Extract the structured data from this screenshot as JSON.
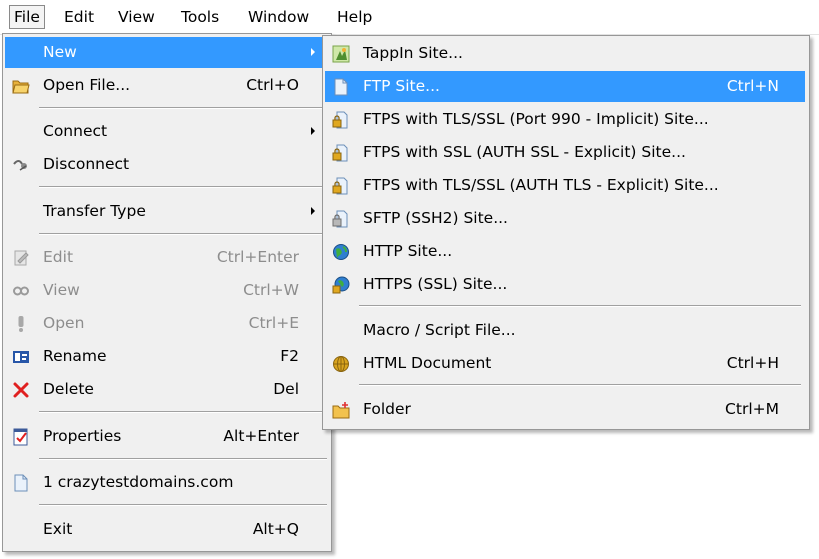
{
  "menubar": {
    "items": [
      "File",
      "Edit",
      "View",
      "Tools",
      "Window",
      "Help"
    ]
  },
  "file_menu": {
    "items": [
      {
        "label": "New",
        "shortcut": "",
        "submenu": true,
        "state": "highlighted",
        "icon": "none"
      },
      {
        "label": "Open File...",
        "shortcut": "Ctrl+O",
        "icon": "open-folder-icon"
      },
      {
        "label": "Connect",
        "shortcut": "",
        "submenu": true,
        "icon": "none"
      },
      {
        "label": "Disconnect",
        "shortcut": "",
        "icon": "disconnect-icon"
      },
      {
        "label": "Transfer Type",
        "shortcut": "",
        "submenu": true,
        "icon": "none"
      },
      {
        "label": "Edit",
        "shortcut": "Ctrl+Enter",
        "state": "disabled",
        "icon": "edit-icon"
      },
      {
        "label": "View",
        "shortcut": "Ctrl+W",
        "state": "disabled",
        "icon": "view-icon"
      },
      {
        "label": "Open",
        "shortcut": "Ctrl+E",
        "state": "disabled",
        "icon": "open-icon"
      },
      {
        "label": "Rename",
        "shortcut": "F2",
        "icon": "rename-icon"
      },
      {
        "label": "Delete",
        "shortcut": "Del",
        "icon": "delete-icon"
      },
      {
        "label": "Properties",
        "shortcut": "Alt+Enter",
        "icon": "properties-icon"
      },
      {
        "label": "1 crazytestdomains.com",
        "shortcut": "",
        "icon": "document-icon"
      },
      {
        "label": "Exit",
        "shortcut": "Alt+Q",
        "icon": "none"
      }
    ]
  },
  "new_submenu": {
    "items": [
      {
        "label": "TappIn Site...",
        "shortcut": "",
        "icon": "tappin-icon"
      },
      {
        "label": "FTP Site...",
        "shortcut": "Ctrl+N",
        "state": "highlighted",
        "icon": "document-icon"
      },
      {
        "label": "FTPS with TLS/SSL (Port 990 - Implicit) Site...",
        "shortcut": "",
        "icon": "lock-document-icon"
      },
      {
        "label": "FTPS with SSL (AUTH SSL - Explicit) Site...",
        "shortcut": "",
        "icon": "lock-document-icon"
      },
      {
        "label": "FTPS with TLS/SSL (AUTH TLS - Explicit) Site...",
        "shortcut": "",
        "icon": "lock-document-icon"
      },
      {
        "label": "SFTP (SSH2) Site...",
        "shortcut": "",
        "icon": "lock-document-icon"
      },
      {
        "label": "HTTP Site...",
        "shortcut": "",
        "icon": "globe-icon"
      },
      {
        "label": "HTTPS (SSL) Site...",
        "shortcut": "",
        "icon": "secure-globe-icon"
      },
      {
        "label": "Macro / Script File...",
        "shortcut": "",
        "icon": "none"
      },
      {
        "label": "HTML Document",
        "shortcut": "Ctrl+H",
        "icon": "html-icon"
      },
      {
        "label": "Folder",
        "shortcut": "Ctrl+M",
        "icon": "new-folder-icon"
      }
    ]
  },
  "colors": {
    "highlight": "#3399ff",
    "menu_bg": "#f0f0f0",
    "disabled_text": "#8d8d8d",
    "delete_red": "#e02020"
  }
}
